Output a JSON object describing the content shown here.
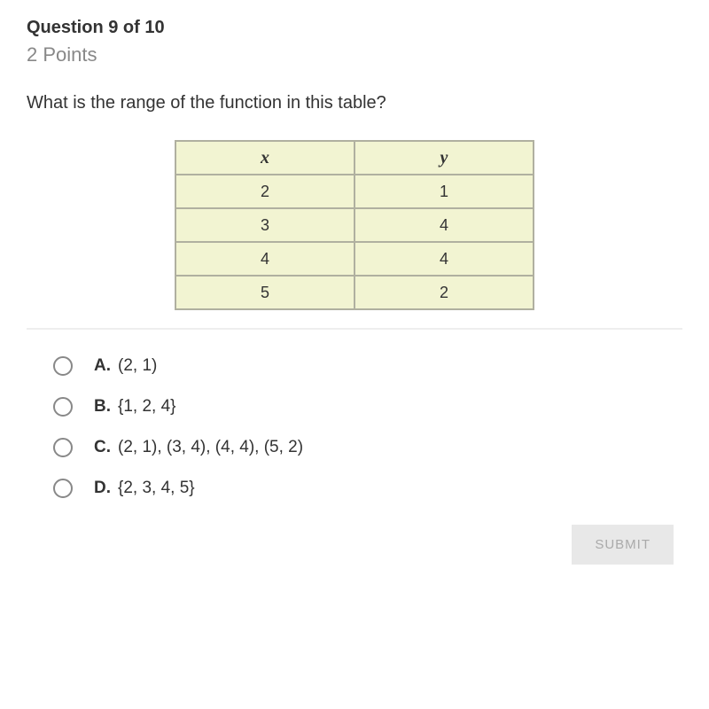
{
  "header": {
    "question_label": "Question 9 of 10",
    "points": "2 Points"
  },
  "question": "What is the range of the function in this table?",
  "table": {
    "headers": {
      "x": "x",
      "y": "y"
    },
    "rows": [
      {
        "x": "2",
        "y": "1"
      },
      {
        "x": "3",
        "y": "4"
      },
      {
        "x": "4",
        "y": "4"
      },
      {
        "x": "5",
        "y": "2"
      }
    ]
  },
  "options": [
    {
      "key": "A.",
      "text": "(2, 1)"
    },
    {
      "key": "B.",
      "text": "{1, 2, 4}"
    },
    {
      "key": "C.",
      "text": "(2, 1), (3, 4), (4, 4), (5, 2)"
    },
    {
      "key": "D.",
      "text": "{2, 3, 4, 5}"
    }
  ],
  "submit_label": "SUBMIT"
}
